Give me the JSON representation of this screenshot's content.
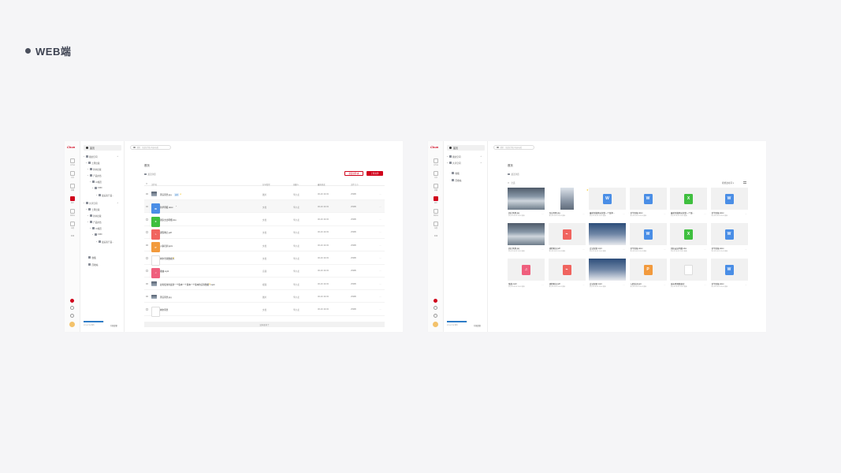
{
  "section": {
    "title": "WEB端"
  },
  "app": {
    "logo": "Chun"
  },
  "rail": {
    "labels": [
      "文件夹",
      "共享",
      "收藏",
      "最近",
      "回收站",
      "设置"
    ]
  },
  "tree": {
    "home": "首页",
    "items": [
      "我的空间",
      "上周出版",
      "新书出版",
      "产品文档",
      "UI规范",
      "FRD",
      "最后商产品...",
      "共享空间",
      "上周出版",
      "新书出版",
      "产品文档",
      "UI规范",
      "FRD",
      "最后商产品..."
    ],
    "extras": [
      "收藏",
      "回收站"
    ],
    "storage_used": "325G/2TB 我的",
    "storage_link": "升级套餐"
  },
  "search": {
    "placeholder": "搜索：全部文件名/内容/标签"
  },
  "left": {
    "breadcrumb": "首页",
    "sub_link": "最近浏览",
    "btn_new_folder": "新建文件夹",
    "btn_upload": "上传文件",
    "columns": [
      "文件名",
      "分享类型",
      "创建人",
      "最新修改",
      "文件大小"
    ],
    "rows": [
      {
        "name": "周庄风景.jpg",
        "type": "图片",
        "owner": "李小龙",
        "date": "06-29 19:03",
        "size": "25MB",
        "icon": "img",
        "badge": "协作",
        "star": true
      },
      {
        "name": "新华周报.docx",
        "type": "文档",
        "owner": "李小龙",
        "date": "06-29 19:03",
        "size": "25MB",
        "icon": "w",
        "star": false,
        "dot": true
      },
      {
        "name": "团队支出明细.xlsx",
        "type": "文档",
        "owner": "李小龙",
        "date": "06-29 19:03",
        "size": "25MB",
        "icon": "x"
      },
      {
        "name": "课程笔记.pdf",
        "type": "文档",
        "owner": "李小龙",
        "date": "06-29 19:03",
        "size": "25MB",
        "icon": "pdf"
      },
      {
        "name": "入职培训.pptx",
        "type": "文档",
        "owner": "李小龙",
        "date": "06-29 19:03",
        "size": "25MB",
        "icon": "p"
      },
      {
        "name": "城市景观数据库",
        "type": "文档",
        "owner": "李小龙",
        "date": "06-29 19:03",
        "size": "25MB",
        "icon": "blank",
        "star": true
      },
      {
        "name": "歌曲.mp3",
        "type": "音频",
        "owner": "李小龙",
        "date": "06-29 19:03",
        "size": "25MB",
        "icon": "mus"
      },
      {
        "name": "如何使用的最新一个版本一个版本一个版本的实际数据...mp4",
        "type": "视频",
        "owner": "李小龙",
        "date": "06-29 19:03",
        "size": "25MB",
        "icon": "img",
        "star": true
      },
      {
        "name": "周庄风景.jpg",
        "type": "图片",
        "owner": "李小龙",
        "date": "06-29 19:03",
        "size": "25MB",
        "icon": "img"
      },
      {
        "name": "城市风景",
        "type": "文档",
        "owner": "李小龙",
        "date": "06-29 19:03",
        "size": "25MB",
        "icon": "blank"
      }
    ],
    "footer": "没有更多了"
  },
  "right": {
    "breadcrumb": "首页",
    "sub_link": "最近浏览",
    "tree_items": [
      "我的空间",
      "共享空间"
    ],
    "extras": [
      "收藏",
      "回收站"
    ],
    "grid_label": "全选",
    "sort_label": "按修改时间",
    "cards": [
      {
        "name": "周庄风景.jpg",
        "meta": "李小龙 06-29 19:03 更新",
        "kind": "photo"
      },
      {
        "name": "周庄风景.jpg",
        "meta": "李小龙 06-29 19:03 更新",
        "kind": "sky",
        "star": true
      },
      {
        "name": "最新新媒体运营第一个版本...",
        "meta": "李小龙 06-29 19:03 更新",
        "kind": "w"
      },
      {
        "name": "新华周报.docx",
        "meta": "李小龙 06-29 19:03 更新",
        "kind": "w"
      },
      {
        "name": "最新新媒体运营第一个版...",
        "meta": "李小龙 06-29 19:03 更新",
        "kind": "x"
      },
      {
        "name": "新华周报.docx",
        "meta": "李小龙 06-29 19:03 更新",
        "kind": "w"
      },
      {
        "name": "周庄风景.jpg",
        "meta": "李小龙 06-29 19:03 更新",
        "kind": "photo"
      },
      {
        "name": "课程笔记.pdf",
        "meta": "李小龙 06-29 19:03 更新",
        "kind": "pdf"
      },
      {
        "name": "会议纪要.mp4",
        "meta": "李小龙 06-29 19:03 更新",
        "kind": "ppl"
      },
      {
        "name": "新华周报.docx",
        "meta": "李小龙 06-29 19:03 更新",
        "kind": "w"
      },
      {
        "name": "团队支出明细.xlsx",
        "meta": "李小龙 06-29 19:03 更新",
        "kind": "x"
      },
      {
        "name": "新华周报.docx",
        "meta": "李小龙 06-29 19:03 更新",
        "kind": "w"
      },
      {
        "name": "歌曲.mp3",
        "meta": "李小龙 06-29 19:03 更新",
        "kind": "mus"
      },
      {
        "name": "课程笔记.pdf",
        "meta": "李小龙 06-29 19:03 更新",
        "kind": "pdf"
      },
      {
        "name": "会议纪要.mp4",
        "meta": "李小龙 06-29 19:03 更新",
        "kind": "ppl"
      },
      {
        "name": "入职培训.ppt",
        "meta": "李小龙 06-29 19:03 更新",
        "kind": "p"
      },
      {
        "name": "城市景观数据库",
        "meta": "李小龙 06-29 19:03 更新",
        "kind": "blank"
      },
      {
        "name": "新华周报.docx",
        "meta": "李小龙 06-29 19:03 更新",
        "kind": "w"
      }
    ]
  },
  "colors": {
    "accent": "#d0021b",
    "word": "#4a8ee6",
    "excel": "#3fbf3f",
    "ppt": "#f29a3d",
    "pdf": "#f0645f"
  }
}
